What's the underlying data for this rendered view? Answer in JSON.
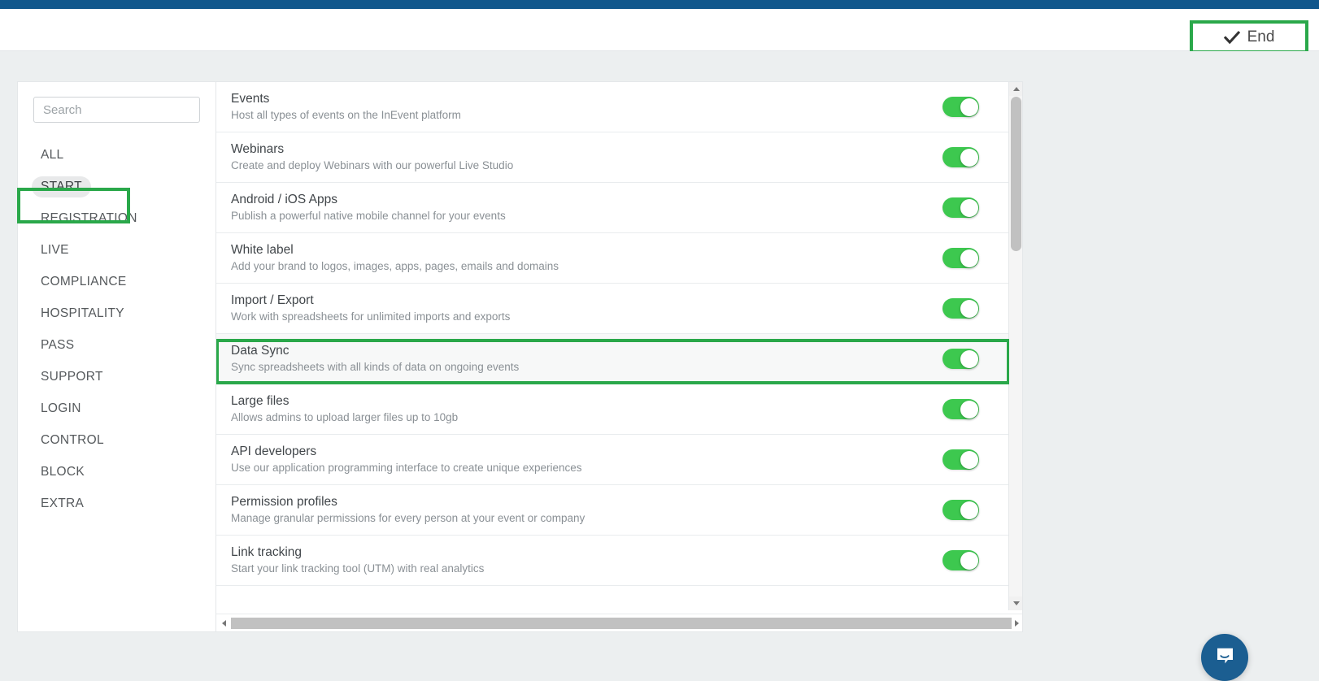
{
  "topbar": {
    "end_label": "End",
    "end_icon": "check-icon",
    "accent_blue": "#11578c",
    "highlight_green": "#2aa84a"
  },
  "sidebar": {
    "search": {
      "placeholder": "Search",
      "value": ""
    },
    "items": [
      {
        "label": "ALL",
        "active": false
      },
      {
        "label": "START",
        "active": true
      },
      {
        "label": "REGISTRATION",
        "active": false
      },
      {
        "label": "LIVE",
        "active": false
      },
      {
        "label": "COMPLIANCE",
        "active": false
      },
      {
        "label": "HOSPITALITY",
        "active": false
      },
      {
        "label": "PASS",
        "active": false
      },
      {
        "label": "SUPPORT",
        "active": false
      },
      {
        "label": "LOGIN",
        "active": false
      },
      {
        "label": "CONTROL",
        "active": false
      },
      {
        "label": "BLOCK",
        "active": false
      },
      {
        "label": "EXTRA",
        "active": false
      }
    ]
  },
  "features": [
    {
      "title": "Events",
      "description": "Host all types of events on the InEvent platform",
      "toggle_on": true,
      "highlighted": false
    },
    {
      "title": "Webinars",
      "description": "Create and deploy Webinars with our powerful Live Studio",
      "toggle_on": true,
      "highlighted": false
    },
    {
      "title": "Android / iOS Apps",
      "description": "Publish a powerful native mobile channel for your events",
      "toggle_on": true,
      "highlighted": false
    },
    {
      "title": "White label",
      "description": "Add your brand to logos, images, apps, pages, emails and domains",
      "toggle_on": true,
      "highlighted": false
    },
    {
      "title": "Import / Export",
      "description": "Work with spreadsheets for unlimited imports and exports",
      "toggle_on": true,
      "highlighted": false
    },
    {
      "title": "Data Sync",
      "description": "Sync spreadsheets with all kinds of data on ongoing events",
      "toggle_on": true,
      "highlighted": true
    },
    {
      "title": "Large files",
      "description": "Allows admins to upload larger files up to 10gb",
      "toggle_on": true,
      "highlighted": false
    },
    {
      "title": "API developers",
      "description": "Use our application programming interface to create unique experiences",
      "toggle_on": true,
      "highlighted": false
    },
    {
      "title": "Permission profiles",
      "description": "Manage granular permissions for every person at your event or company",
      "toggle_on": true,
      "highlighted": false
    },
    {
      "title": "Link tracking",
      "description": "Start your link tracking tool (UTM) with real analytics",
      "toggle_on": true,
      "highlighted": false
    }
  ],
  "scrollbars": {
    "vertical_arrow_up": "triangle-up-icon",
    "vertical_arrow_down": "triangle-down-icon",
    "horizontal_arrow_left": "triangle-left-icon",
    "horizontal_arrow_right": "triangle-right-icon"
  },
  "intercom": {
    "icon": "message-bubble-icon",
    "color": "#1b5e91"
  }
}
